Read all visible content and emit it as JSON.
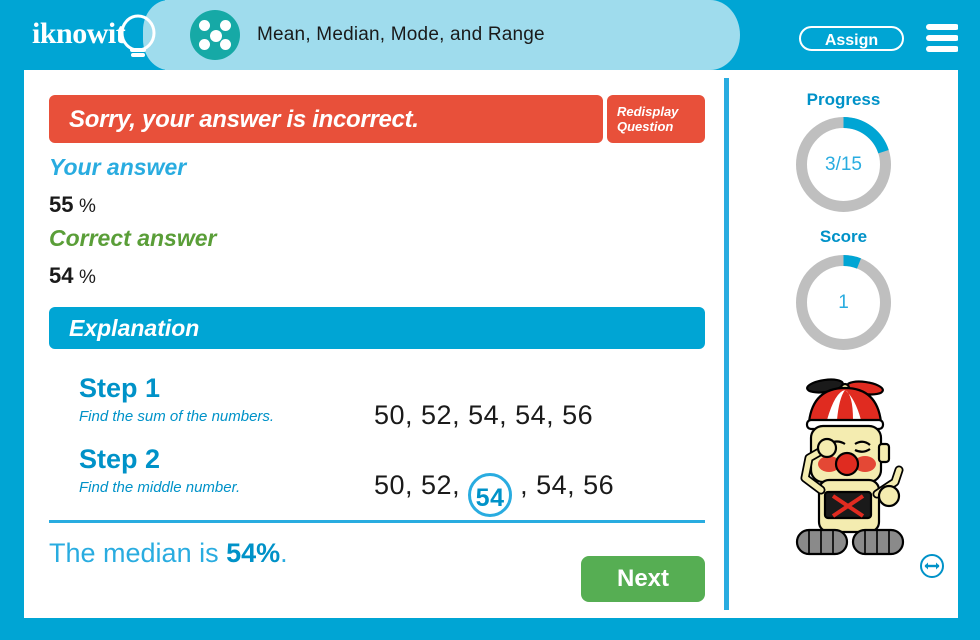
{
  "header": {
    "logo_text": "iknowit",
    "logo_icon": "lightbulb-icon",
    "subject_icon": "five-dots-circle-icon",
    "lesson_title": "Mean, Median, Mode, and Range",
    "assign_label": "Assign",
    "menu_icon": "hamburger-menu-icon"
  },
  "feedback": {
    "message": "Sorry, your answer is incorrect.",
    "redisplay_line1": "Redisplay",
    "redisplay_line2": "Question",
    "bar_color": "#e8503a"
  },
  "answers": {
    "your_label": "Your answer",
    "your_value": "55",
    "your_unit": "%",
    "correct_label": "Correct answer",
    "correct_value": "54",
    "correct_unit": "%",
    "your_color": "#29ace0",
    "correct_color": "#5a9e38"
  },
  "explanation": {
    "heading": "Explanation",
    "heading_color": "#00a5d4",
    "steps": [
      {
        "number": "Step 1",
        "description": "Find the sum of the numbers.",
        "expression": "50, 52, 54, 54, 56"
      },
      {
        "number": "Step 2",
        "description": "Find the middle number.",
        "expression_prefix": "50, 52, ",
        "highlighted": "54",
        "expression_suffix": " , 54, 56"
      }
    ],
    "conclusion_prefix": "The median is ",
    "conclusion_highlight": "54%",
    "conclusion_suffix": "."
  },
  "footer": {
    "next_label": "Next"
  },
  "sidebar": {
    "progress": {
      "title": "Progress",
      "value": "3/15",
      "percent": 20,
      "fill_color": "#00a5d4",
      "track_color": "#bfbfbf"
    },
    "score": {
      "title": "Score",
      "value": "1",
      "percent": 6,
      "fill_color": "#00a5d4",
      "track_color": "#bfbfbf"
    },
    "mascot": "robot-mascot-propeller-hat",
    "resize_icon": "horizontal-resize-icon"
  },
  "theme": {
    "frame_color": "#00a5d4",
    "header_tab_color": "#9fdced",
    "accent_color": "#29ace0",
    "next_button_color": "#56ae53"
  }
}
